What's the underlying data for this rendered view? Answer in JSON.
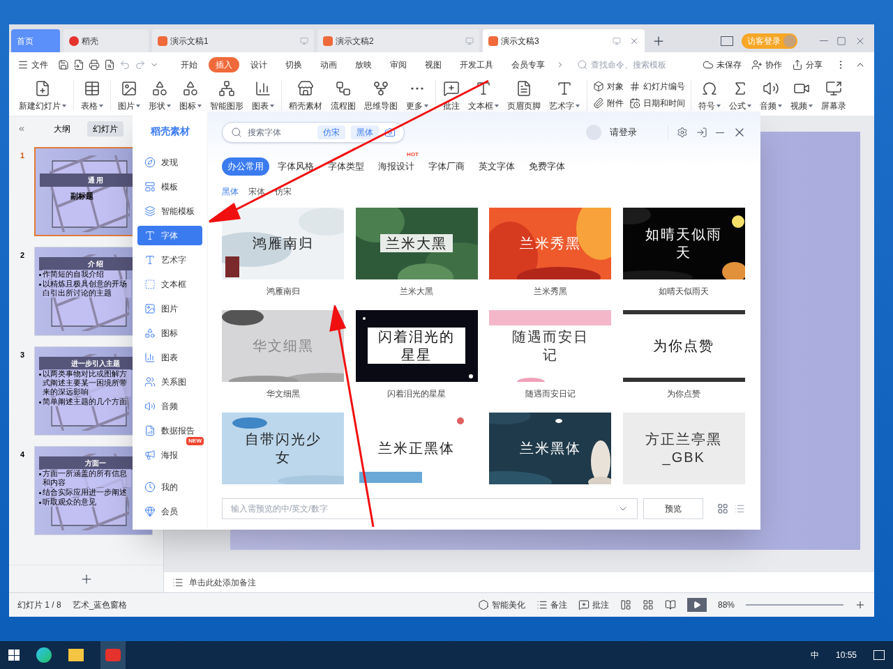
{
  "tabs": [
    {
      "label": "首页",
      "kind": "home",
      "selected": false
    },
    {
      "label": "稻壳",
      "kind": "docer",
      "selected": false
    },
    {
      "label": "演示文稿1",
      "kind": "doc",
      "selected": false
    },
    {
      "label": "演示文稿2",
      "kind": "doc",
      "selected": false
    },
    {
      "label": "演示文稿3",
      "kind": "doc",
      "selected": true
    }
  ],
  "login_button": "访客登录",
  "menu": [
    {
      "label": "开始",
      "selected": false
    },
    {
      "label": "插入",
      "selected": true
    },
    {
      "label": "设计",
      "selected": false
    },
    {
      "label": "切换",
      "selected": false
    },
    {
      "label": "动画",
      "selected": false
    },
    {
      "label": "放映",
      "selected": false
    },
    {
      "label": "审阅",
      "selected": false
    },
    {
      "label": "视图",
      "selected": false
    },
    {
      "label": "开发工具",
      "selected": false
    },
    {
      "label": "会员专享",
      "selected": false
    }
  ],
  "file_menu": "文件",
  "command_search": {
    "placeholder": "查找命令、搜索模板"
  },
  "menu_right": [
    "未保存",
    "协作",
    "分享"
  ],
  "ribbon": [
    {
      "label": "新建幻灯片",
      "dropdown": true
    },
    {
      "label": "表格",
      "dropdown": true
    },
    {
      "label": "图片",
      "dropdown": true
    },
    {
      "label": "形状",
      "dropdown": true
    },
    {
      "label": "图标",
      "dropdown": true
    },
    {
      "label": "智能图形",
      "dropdown": false
    },
    {
      "label": "图表",
      "dropdown": true
    },
    {
      "label": "稻壳素材",
      "dropdown": false
    },
    {
      "label": "流程图",
      "dropdown": false
    },
    {
      "label": "思维导图",
      "dropdown": false
    },
    {
      "label": "更多",
      "dropdown": true
    },
    {
      "label": "批注",
      "dropdown": false
    },
    {
      "label": "文本框",
      "dropdown": true
    },
    {
      "label": "页眉页脚",
      "dropdown": false
    },
    {
      "label": "艺术字",
      "dropdown": true
    }
  ],
  "ribbon_small": [
    "对象",
    "幻灯片编号",
    "附件",
    "日期和时间"
  ],
  "ribbon_more": [
    {
      "label": "符号",
      "dropdown": true
    },
    {
      "label": "公式",
      "dropdown": true
    },
    {
      "label": "音频",
      "dropdown": true
    },
    {
      "label": "视频",
      "dropdown": true
    },
    {
      "label": "屏幕录",
      "dropdown": false
    }
  ],
  "pane_tabs": [
    {
      "label": "大纲",
      "selected": false
    },
    {
      "label": "幻灯片",
      "selected": true
    }
  ],
  "slides": [
    {
      "number": "1",
      "title": "通 用",
      "subtitle": "副标题",
      "selected": true
    },
    {
      "number": "2",
      "title": "介 绍",
      "bullets": [
        "作简短的自我介绍",
        "以精炼且极具创意的开场白引出所讨论的主题"
      ],
      "selected": false
    },
    {
      "number": "3",
      "title": "进一步引入主题",
      "bullets": [
        "以两类事物对比或图解方式阐述主要某一困境所带来的深远影响",
        "简单阐述主题的几个方面"
      ],
      "selected": false
    },
    {
      "number": "4",
      "title": "方面一",
      "bullets": [
        "方面一所涵盖的所有信息和内容",
        "结合实际应用进一步阐述",
        "听取观众的意见"
      ],
      "selected": false
    }
  ],
  "notes_placeholder": "单击此处添加备注",
  "status_bar": {
    "slide": "幻灯片 1 / 8",
    "theme": "艺术_蓝色窗格",
    "beautify": "智能美化",
    "notes": "备注",
    "comment": "批注",
    "zoom": "88%"
  },
  "dialog": {
    "brand": "稻壳素材",
    "search": {
      "placeholder": "搜索字体",
      "chips": [
        "仿宋",
        "黑体"
      ]
    },
    "login": "请登录",
    "nav": [
      {
        "label": "发现",
        "selected": false
      },
      {
        "label": "模板",
        "selected": false
      },
      {
        "label": "智能模板",
        "selected": false
      },
      {
        "label": "字体",
        "selected": true
      },
      {
        "label": "艺术字",
        "selected": false
      },
      {
        "label": "文本框",
        "selected": false
      },
      {
        "label": "图片",
        "selected": false
      },
      {
        "label": "图标",
        "selected": false
      },
      {
        "label": "图表",
        "selected": false
      },
      {
        "label": "关系图",
        "selected": false
      },
      {
        "label": "音频",
        "selected": false
      },
      {
        "label": "数据报告",
        "selected": false
      },
      {
        "label": "海报",
        "selected": false,
        "badge": "NEW"
      }
    ],
    "nav_bottom": [
      "我的",
      "会员"
    ],
    "categories": [
      {
        "label": "办公常用",
        "selected": true
      },
      {
        "label": "字体风格",
        "selected": false
      },
      {
        "label": "字体类型",
        "selected": false
      },
      {
        "label": "海报设计",
        "selected": false,
        "badge": "HOT"
      },
      {
        "label": "字体厂商",
        "selected": false
      },
      {
        "label": "英文字体",
        "selected": false
      },
      {
        "label": "免费字体",
        "selected": false
      }
    ],
    "subcategories": [
      {
        "label": "黑体",
        "selected": true
      },
      {
        "label": "宋体",
        "selected": false
      },
      {
        "label": "仿宋",
        "selected": false
      }
    ],
    "fonts": [
      {
        "name": "鸿雁南归",
        "preview": "鸿雁南归"
      },
      {
        "name": "兰米大黑",
        "preview": "兰米大黑"
      },
      {
        "name": "兰米秀黑",
        "preview": "兰米秀黑"
      },
      {
        "name": "如晴天似雨天",
        "preview": "如晴天似雨天"
      },
      {
        "name": "华文细黑",
        "preview": "华文细黑"
      },
      {
        "name": "闪着泪光的星星",
        "preview": "闪着泪光的星星"
      },
      {
        "name": "随遇而安日记",
        "preview": "随遇而安日记"
      },
      {
        "name": "为你点赞",
        "preview": "为你点赞"
      },
      {
        "preview": "自带闪光少女"
      },
      {
        "preview": "兰米正黑体"
      },
      {
        "preview": "兰米黑体"
      },
      {
        "preview": "方正兰亭黑_GBK"
      }
    ],
    "preview_input": {
      "placeholder": "输入需预览的中/英文/数字"
    },
    "preview_button": "预览"
  },
  "taskbar": {
    "ime": "中",
    "time": "10:55"
  }
}
